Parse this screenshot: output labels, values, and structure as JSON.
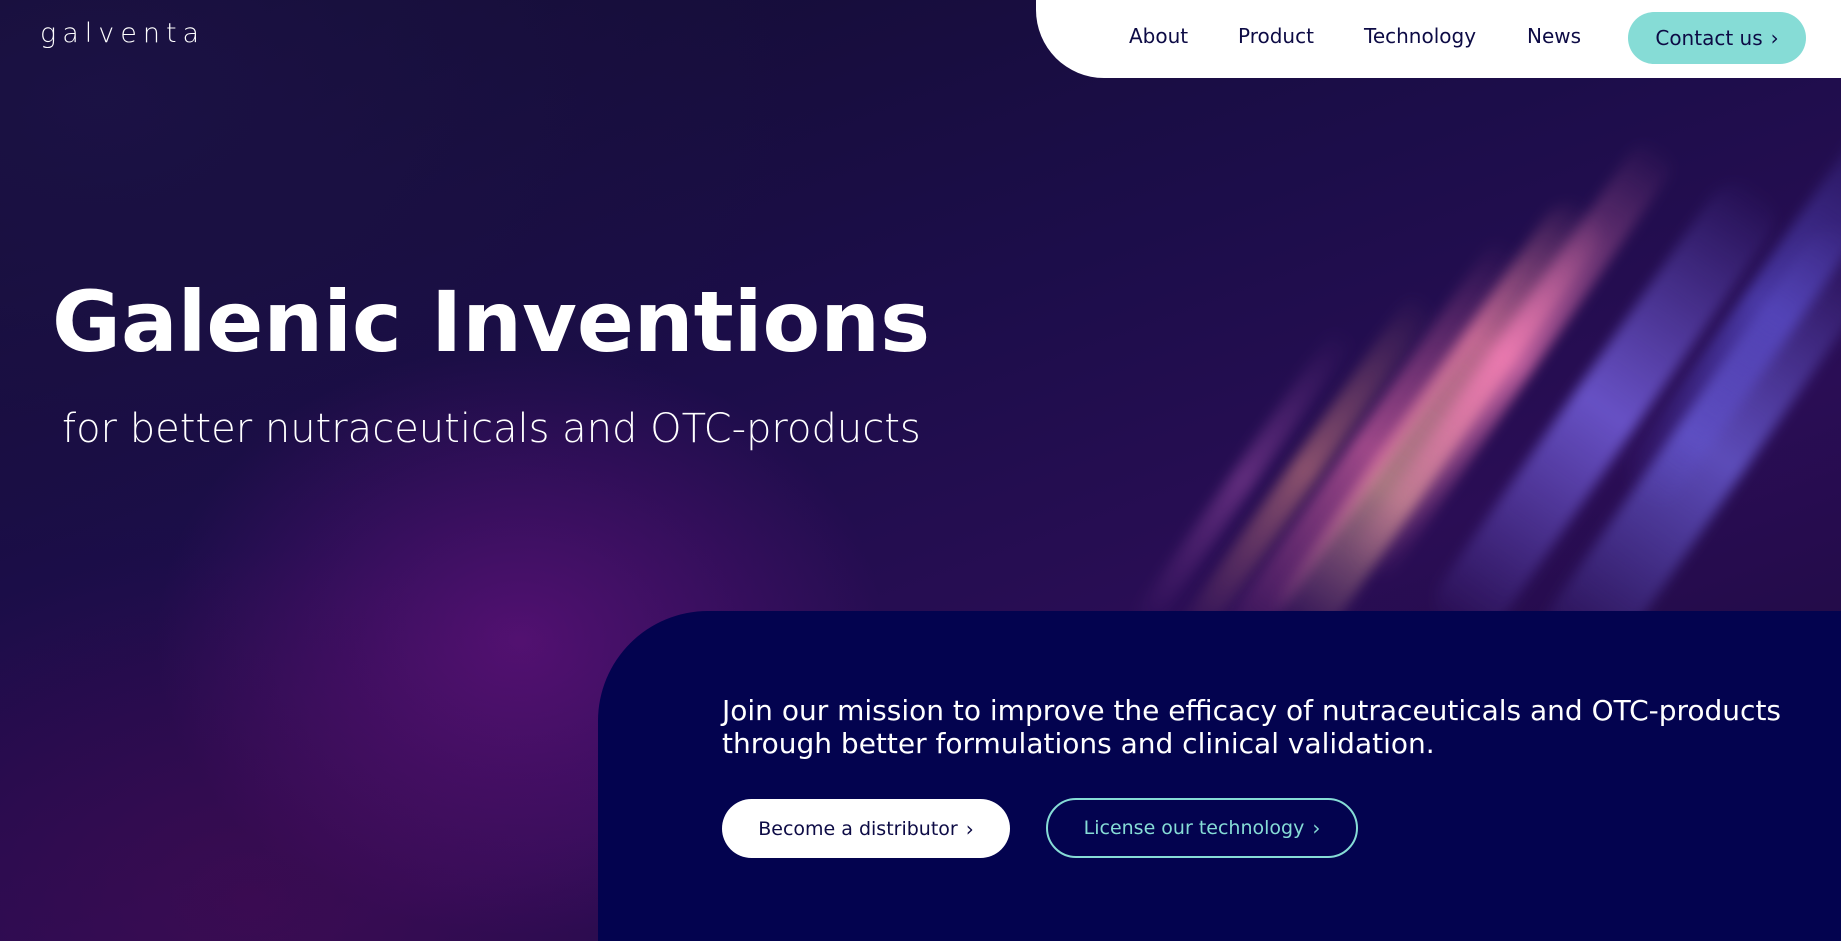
{
  "brand": {
    "logo_text": "GALVENTA"
  },
  "nav": {
    "items": [
      {
        "label": "About"
      },
      {
        "label": "Product"
      },
      {
        "label": "Technology"
      },
      {
        "label": "News"
      }
    ],
    "contact_label": "Contact us"
  },
  "hero": {
    "title": "Galenic Inventions",
    "subtitle": "for better nutraceuticals and OTC-products"
  },
  "mission": {
    "text": "Join our mission to improve the efficacy of nutraceuticals and OTC-products through better formulations and clinical validation.",
    "distributor_label": "Become a distributor",
    "license_label": "License our technology"
  },
  "icons": {
    "chevron": "chevron-right-icon"
  },
  "colors": {
    "accent_teal": "#86dcd6",
    "navy": "#03034f",
    "text_dark": "#0d0b45",
    "white": "#ffffff"
  }
}
